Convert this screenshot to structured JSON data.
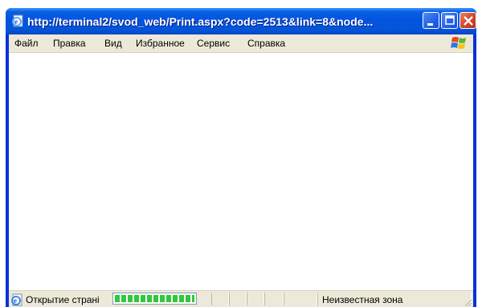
{
  "window": {
    "title": "http://terminal2/svod_web/Print.aspx?code=2513&link=8&node..."
  },
  "menu": {
    "items": [
      {
        "label": "Файл"
      },
      {
        "label": "Правка"
      },
      {
        "label": "Вид"
      },
      {
        "label": "Избранное"
      },
      {
        "label": "Сервис"
      },
      {
        "label": "Справка"
      }
    ]
  },
  "status": {
    "text": "Открытие страні",
    "progress": 1.0,
    "zone": "Неизвестная зона"
  },
  "icons": {
    "title": "ie-page-icon",
    "logo": "windows-logo-icon",
    "status": "ie-page-icon",
    "minimize": "minimize-icon",
    "maximize": "maximize-icon",
    "close": "close-icon"
  }
}
